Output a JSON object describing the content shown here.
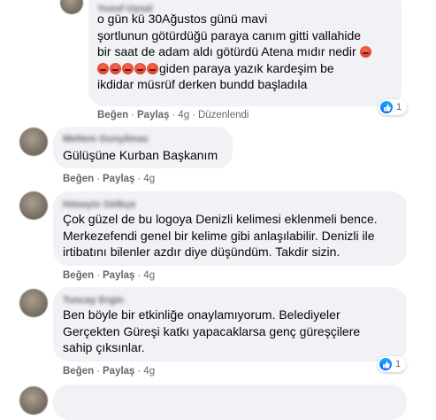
{
  "comments": [
    {
      "author": "Yusuf Uysal",
      "lines": [
        "o gün kü 30Ağustos günü mavi",
        "şortlunun götürdüğü paraya canım gitti vallahide",
        "bir saat de adam aldı götürdü Atena mıdır nedir",
        "giden paraya yazık kardeşim be",
        "ikdidar müsrüf derken bundd başladıla"
      ],
      "like": "Beğen",
      "reply": "Paylaş",
      "time": "4g",
      "edited": "Düzenlendi",
      "reactions": "1"
    },
    {
      "author": "Meltem Gunyilmaz",
      "text": "Gülüşüne Kurban Başkanım",
      "like": "Beğen",
      "reply": "Paylaş",
      "time": "4g"
    },
    {
      "author": "Hüseyin Gölkçe",
      "lines": [
        "Çok güzel de bu logoya Denizli kelimesi eklenmeli bence.",
        "Merkezefendi genel bir kelime gibi anlaşılabilir. Denizli ile",
        "irtibatını bilenler azdır diye düşündüm. Takdir sizin."
      ],
      "like": "Beğen",
      "reply": "Paylaş",
      "time": "4g"
    },
    {
      "author": "Tuncay Ergin",
      "lines": [
        "Ben böyle bir etkinliğe onaylamıyorum. Belediyeler",
        "Gerçekten Güreşi katkı yapacaklarsa genç güreşçilere",
        "sahip çıksınlar."
      ],
      "like": "Beğen",
      "reply": "Paylaş",
      "time": "4g",
      "reactions": "1"
    }
  ],
  "emoji_name": "angry-emoji",
  "accent": "#1877f2"
}
